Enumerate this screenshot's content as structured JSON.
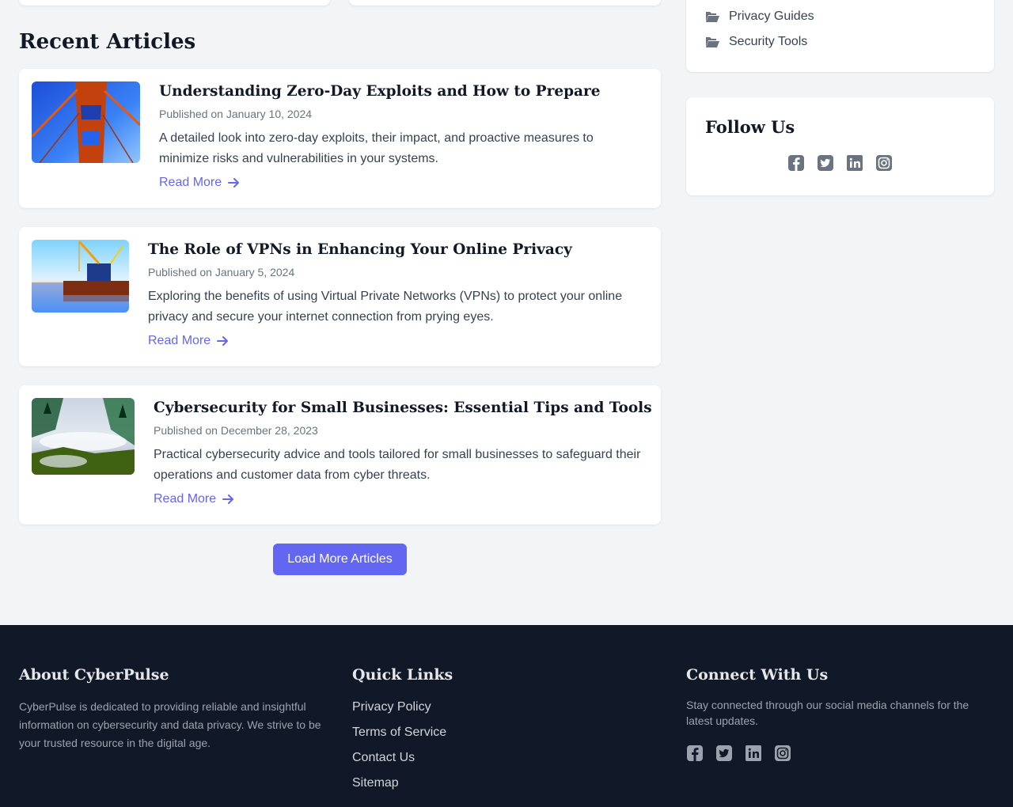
{
  "sidebar": {
    "categories": [
      {
        "label": "Privacy Guides",
        "icon": "folder-open-icon"
      },
      {
        "label": "Security Tools",
        "icon": "folder-open-icon"
      }
    ],
    "follow_title": "Follow Us"
  },
  "main": {
    "section_title": "Recent Articles",
    "articles": [
      {
        "title": "Understanding Zero-Day Exploits and How to Prepare",
        "date": "Published on January 10, 2024",
        "excerpt": "A detailed look into zero-day exploits, their impact, and proactive measures to minimize risks and vulnerabilities in your systems.",
        "read_more": "Read More",
        "image": "bridge-photo"
      },
      {
        "title": "The Role of VPNs in Enhancing Your Online Privacy",
        "date": "Published on January 5, 2024",
        "excerpt": "Exploring the benefits of using Virtual Private Networks (VPNs) to protect your online privacy and secure your internet connection from prying eyes.",
        "read_more": "Read More",
        "image": "crane-ship-photo"
      },
      {
        "title": "Cybersecurity for Small Businesses: Essential Tips and Tools",
        "date": "Published on December 28, 2023",
        "excerpt": "Practical cybersecurity advice and tools tailored for small businesses to safeguard their operations and customer data from cyber threats.",
        "read_more": "Read More",
        "image": "misty-forest-photo"
      }
    ],
    "load_more": "Load More Articles"
  },
  "footer": {
    "about": {
      "title": "About CyberPulse",
      "text": "CyberPulse is dedicated to providing reliable and insightful information on cybersecurity and data privacy. We strive to be your trusted resource in the digital age."
    },
    "quick_links": {
      "title": "Quick Links",
      "links": [
        "Privacy Policy",
        "Terms of Service",
        "Contact Us",
        "Sitemap"
      ]
    },
    "connect": {
      "title": "Connect With Us",
      "text": "Stay connected through our social media channels for the latest updates."
    }
  },
  "social_icons": [
    "facebook-icon",
    "twitter-icon",
    "linkedin-icon",
    "instagram-icon"
  ],
  "colors": {
    "accent": "#6366f1",
    "footer_bg": "#111827",
    "page_bg": "#f3f4f6",
    "heading": "#111827"
  }
}
